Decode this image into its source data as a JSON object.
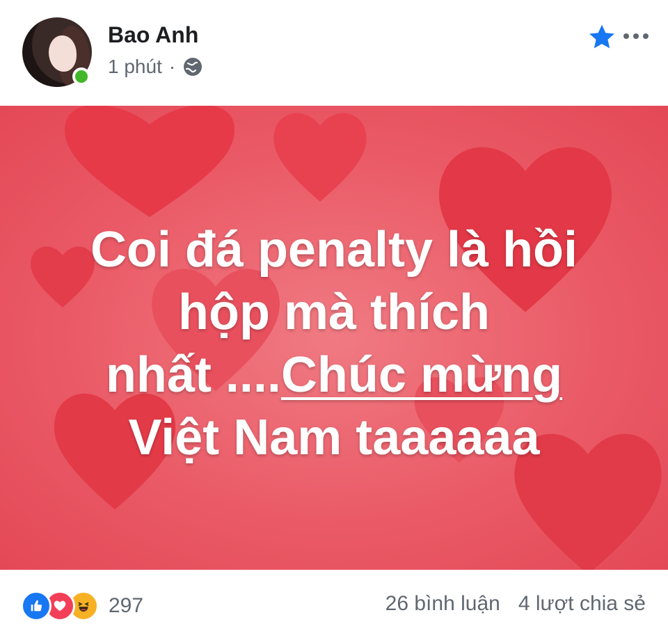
{
  "post": {
    "author": "Bao Anh",
    "time": "1 phút",
    "separator": "·",
    "text_lines": [
      "Coi đá penalty là hồi",
      "hộp mà thích"
    ],
    "text_line3_plain": "nhất ....",
    "text_line3_underlined": "Chúc mừng",
    "text_line4": "Việt Nam taaaaaa"
  },
  "footer": {
    "reaction_count": "297",
    "comments": "26 bình luận",
    "shares": "4 lượt chia sẻ"
  },
  "colors": {
    "accent": "#1877f2",
    "online": "#42b72a",
    "image_bg": "#ea5b67"
  },
  "icons": [
    "star-icon",
    "more-icon",
    "globe-icon",
    "like-icon",
    "love-icon",
    "haha-icon"
  ]
}
